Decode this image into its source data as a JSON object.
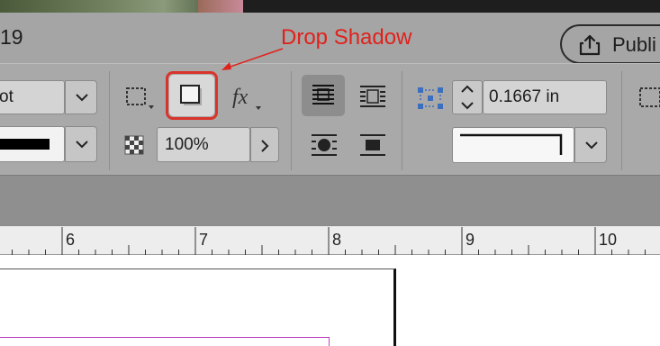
{
  "title_bar": {
    "title_fragment": "19",
    "publish_button_label": "Publi"
  },
  "control_panel": {
    "font_style_value": "ot",
    "stroke_color_swatch": "#000000",
    "opacity_value": "100%",
    "offset_value": "0.1667 in"
  },
  "annotation": {
    "label": "Drop Shadow",
    "color": "#e0211b"
  },
  "ruler": {
    "labels": [
      "6",
      "7",
      "8",
      "9",
      "10"
    ]
  },
  "colors": {
    "title_bar_bg": "#a5a5a5",
    "control_panel_bg": "#a9a9a9",
    "highlight": "#d9332b",
    "frame_edge": "#c040c0"
  }
}
